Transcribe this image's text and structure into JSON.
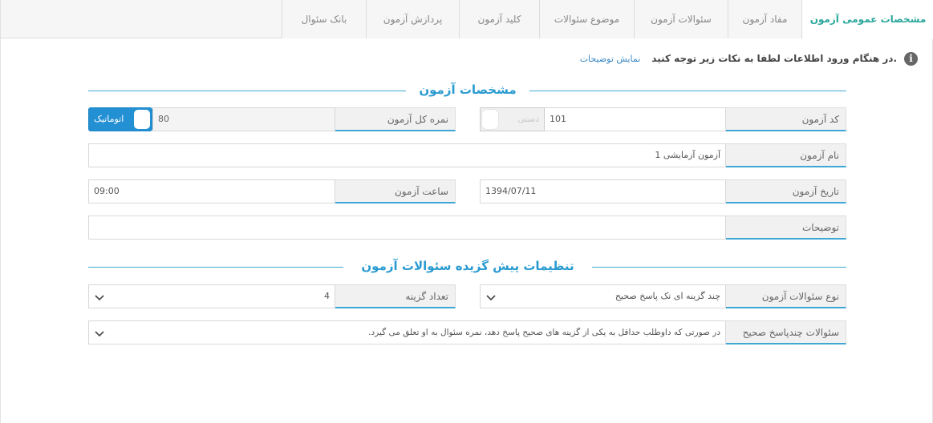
{
  "tabs": [
    {
      "label": "مشخصات عمومی آزمون",
      "active": true
    },
    {
      "label": "مفاد آزمون",
      "active": false
    },
    {
      "label": "سئوالات آزمون",
      "active": false
    },
    {
      "label": "موضوع سئوالات",
      "active": false
    },
    {
      "label": "کلید آزمون",
      "active": false
    },
    {
      "label": "پردازش آزمون",
      "active": false
    },
    {
      "label": "بانک سئوال",
      "active": false
    }
  ],
  "notice": {
    "icon": "info-icon",
    "text": "در هنگام ورود اطلاعات لطفا به نکات زیر توجه کنید.",
    "link": "نمایش توضیحات"
  },
  "section1": {
    "title": "مشخصات آزمون",
    "exam_code": {
      "label": "کد آزمون",
      "value": "101",
      "toggle_text": "دستی",
      "toggle_on": false
    },
    "total_score": {
      "label": "نمره کل آزمون",
      "value": "80",
      "toggle_text": "اتوماتیک",
      "toggle_on": true
    },
    "exam_name": {
      "label": "نام آزمون",
      "value": "آزمون آزمایشی 1"
    },
    "exam_date": {
      "label": "تاریخ آزمون",
      "value": "1394/07/11"
    },
    "exam_time": {
      "label": "ساعت آزمون",
      "value": "09:00"
    },
    "description": {
      "label": "توضیحات",
      "value": ""
    }
  },
  "section2": {
    "title": "تنظیمات پیش گزیده سئوالات آزمون",
    "question_type": {
      "label": "نوع سئوالات آزمون",
      "value": "چند گزینه ای تک پاسخ صحیح"
    },
    "option_count": {
      "label": "تعداد گزینه",
      "value": "4"
    },
    "multi_answer": {
      "label": "سئوالات چندپاسخ صحیح",
      "value": "در صورتی که داوطلب حداقل به یکی از گزینه های صحیح پاسخ دهد، نمره سئوال به او تعلق می گیرد."
    }
  },
  "colors": {
    "accent": "#2aa79b",
    "section": "#2a9bd0",
    "toggle_on": "#2390d4"
  }
}
